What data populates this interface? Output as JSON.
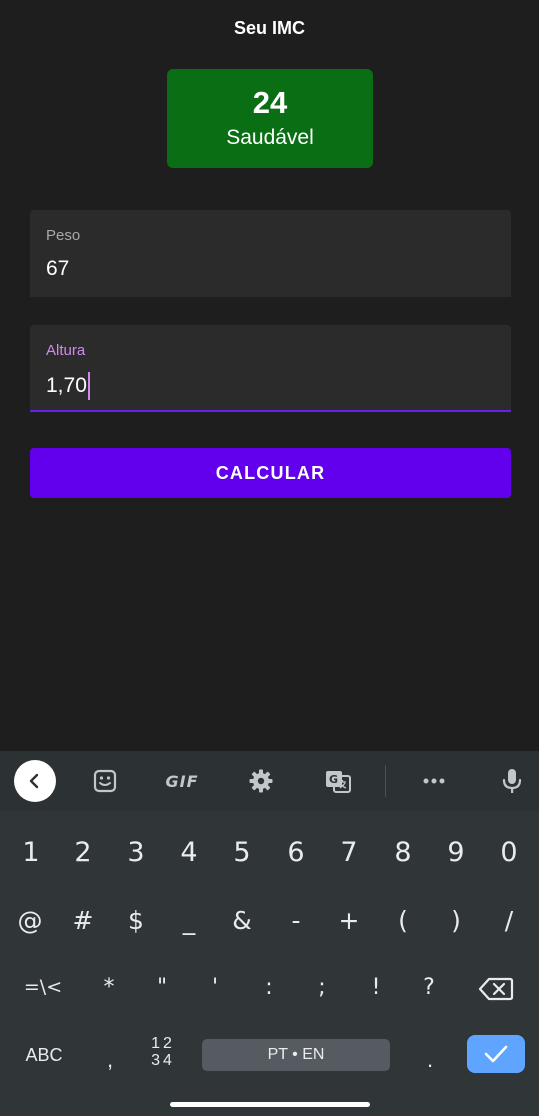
{
  "app": {
    "title": "Seu IMC"
  },
  "result": {
    "value": "24",
    "label": "Saudável",
    "color": "#0a6e14"
  },
  "form": {
    "peso": {
      "label": "Peso",
      "value": "67"
    },
    "altura": {
      "label": "Altura",
      "value": "1,70"
    },
    "button_label": "CALCULAR",
    "accent_color": "#6200ee"
  },
  "keyboard": {
    "toolbar": {
      "back_icon": "chevron-left-icon",
      "sticker_icon": "sticker-icon",
      "gif_label": "GIF",
      "settings_icon": "gear-icon",
      "translate_icon": "translate-icon",
      "more_icon": "more-horizontal-icon",
      "mic_icon": "microphone-icon"
    },
    "row1": [
      "1",
      "2",
      "3",
      "4",
      "5",
      "6",
      "7",
      "8",
      "9",
      "0"
    ],
    "row2": [
      "@",
      "#",
      "$",
      "_",
      "&",
      "-",
      "+",
      "(",
      ")",
      "/"
    ],
    "row3": [
      "=\\<",
      "*",
      "\"",
      "'",
      ":",
      ";",
      "!",
      "?"
    ],
    "abc_label": "ABC",
    "comma_label": ",",
    "digits_label_top": "12",
    "digits_label_bottom": "34",
    "space_label": "PT • EN",
    "period_label": ".",
    "enter_color": "#5fa4ff"
  }
}
